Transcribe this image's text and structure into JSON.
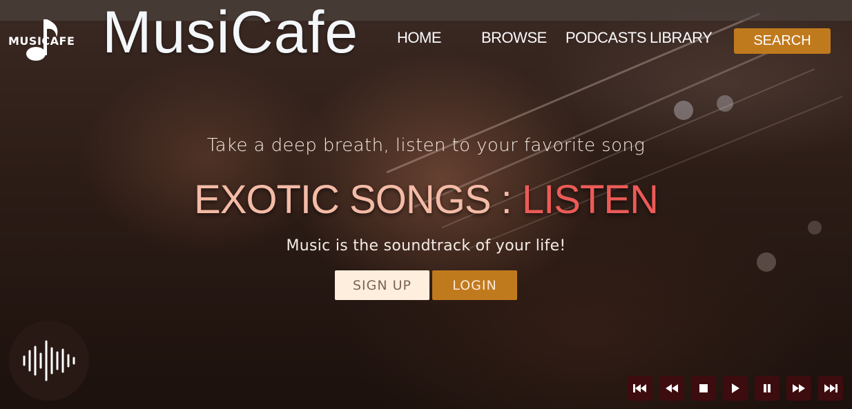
{
  "brand": {
    "logo_text": "MUSICAFE",
    "title": "MusiCafe"
  },
  "nav": {
    "items": [
      {
        "label": "HOME"
      },
      {
        "label": "BROWSE"
      },
      {
        "label": "PODCASTS"
      },
      {
        "label": "LIBRARY"
      }
    ],
    "search_label": "SEARCH"
  },
  "hero": {
    "tagline": "Take a deep breath, listen to your favorite song",
    "headline_part1": "EXOTIC SONGS",
    "headline_separator": ":",
    "headline_part2": "LISTEN",
    "subline": "Music is the soundtrack of your life!",
    "signup_label": "SIGN UP",
    "login_label": "LOGIN"
  },
  "player": {
    "controls": [
      "skip-previous-icon",
      "rewind-icon",
      "stop-icon",
      "play-icon",
      "pause-icon",
      "fast-forward-icon",
      "skip-next-icon"
    ]
  },
  "colors": {
    "accent": "#c07a1e",
    "headline_light": "#f4bba7",
    "headline_red": "#ec5b57",
    "control_bg": "#3d0c0f"
  }
}
